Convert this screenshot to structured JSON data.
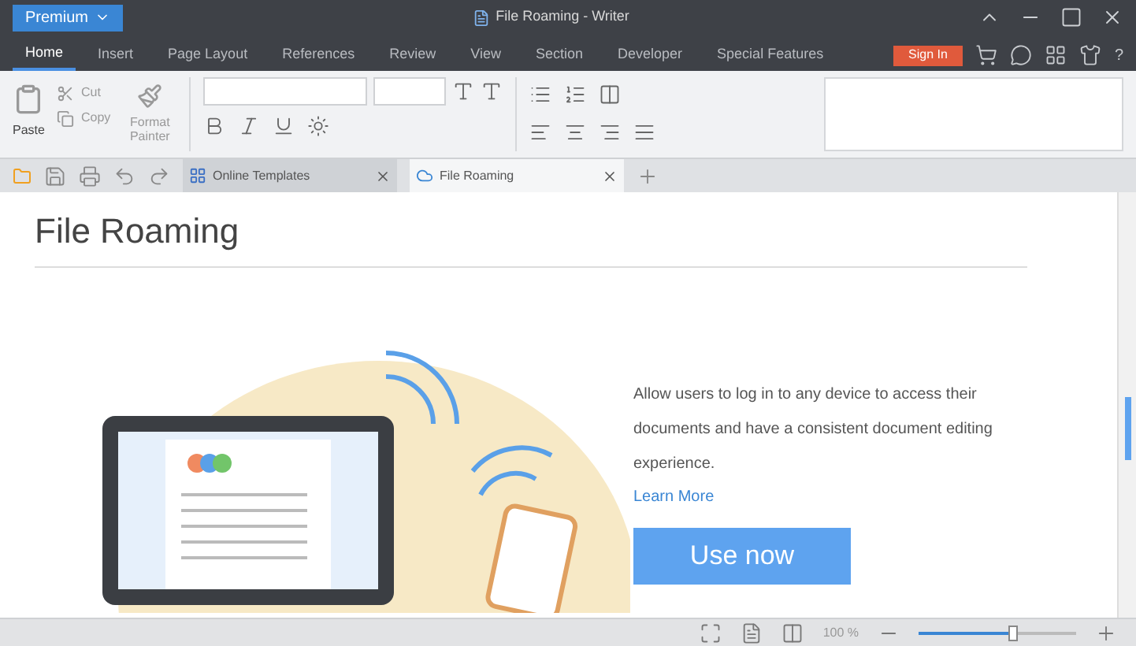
{
  "app_menu": {
    "label": "Premium"
  },
  "window": {
    "title": "File Roaming - Writer"
  },
  "menu_tabs": [
    {
      "label": "Home",
      "selected": true
    },
    {
      "label": "Insert",
      "selected": false
    },
    {
      "label": "Page Layout",
      "selected": false
    },
    {
      "label": "References",
      "selected": false
    },
    {
      "label": "Review",
      "selected": false
    },
    {
      "label": "View",
      "selected": false
    },
    {
      "label": "Section",
      "selected": false
    },
    {
      "label": "Developer",
      "selected": false
    },
    {
      "label": "Special Features",
      "selected": false
    }
  ],
  "sign_in": "Sign In",
  "help": "?",
  "ribbon": {
    "paste": "Paste",
    "cut": "Cut",
    "copy": "Copy",
    "format_painter": "Format Painter"
  },
  "doc_tabs": [
    {
      "label": "Online Templates",
      "selected": false
    },
    {
      "label": "File Roaming",
      "selected": true
    }
  ],
  "content": {
    "heading": "File Roaming",
    "description": "Allow users to log in to any device to access their documents and have a consistent document editing experience.",
    "link": "Learn More",
    "button": "Use now"
  },
  "status_bar": {
    "zoom": "100 %",
    "level": 0.6
  }
}
